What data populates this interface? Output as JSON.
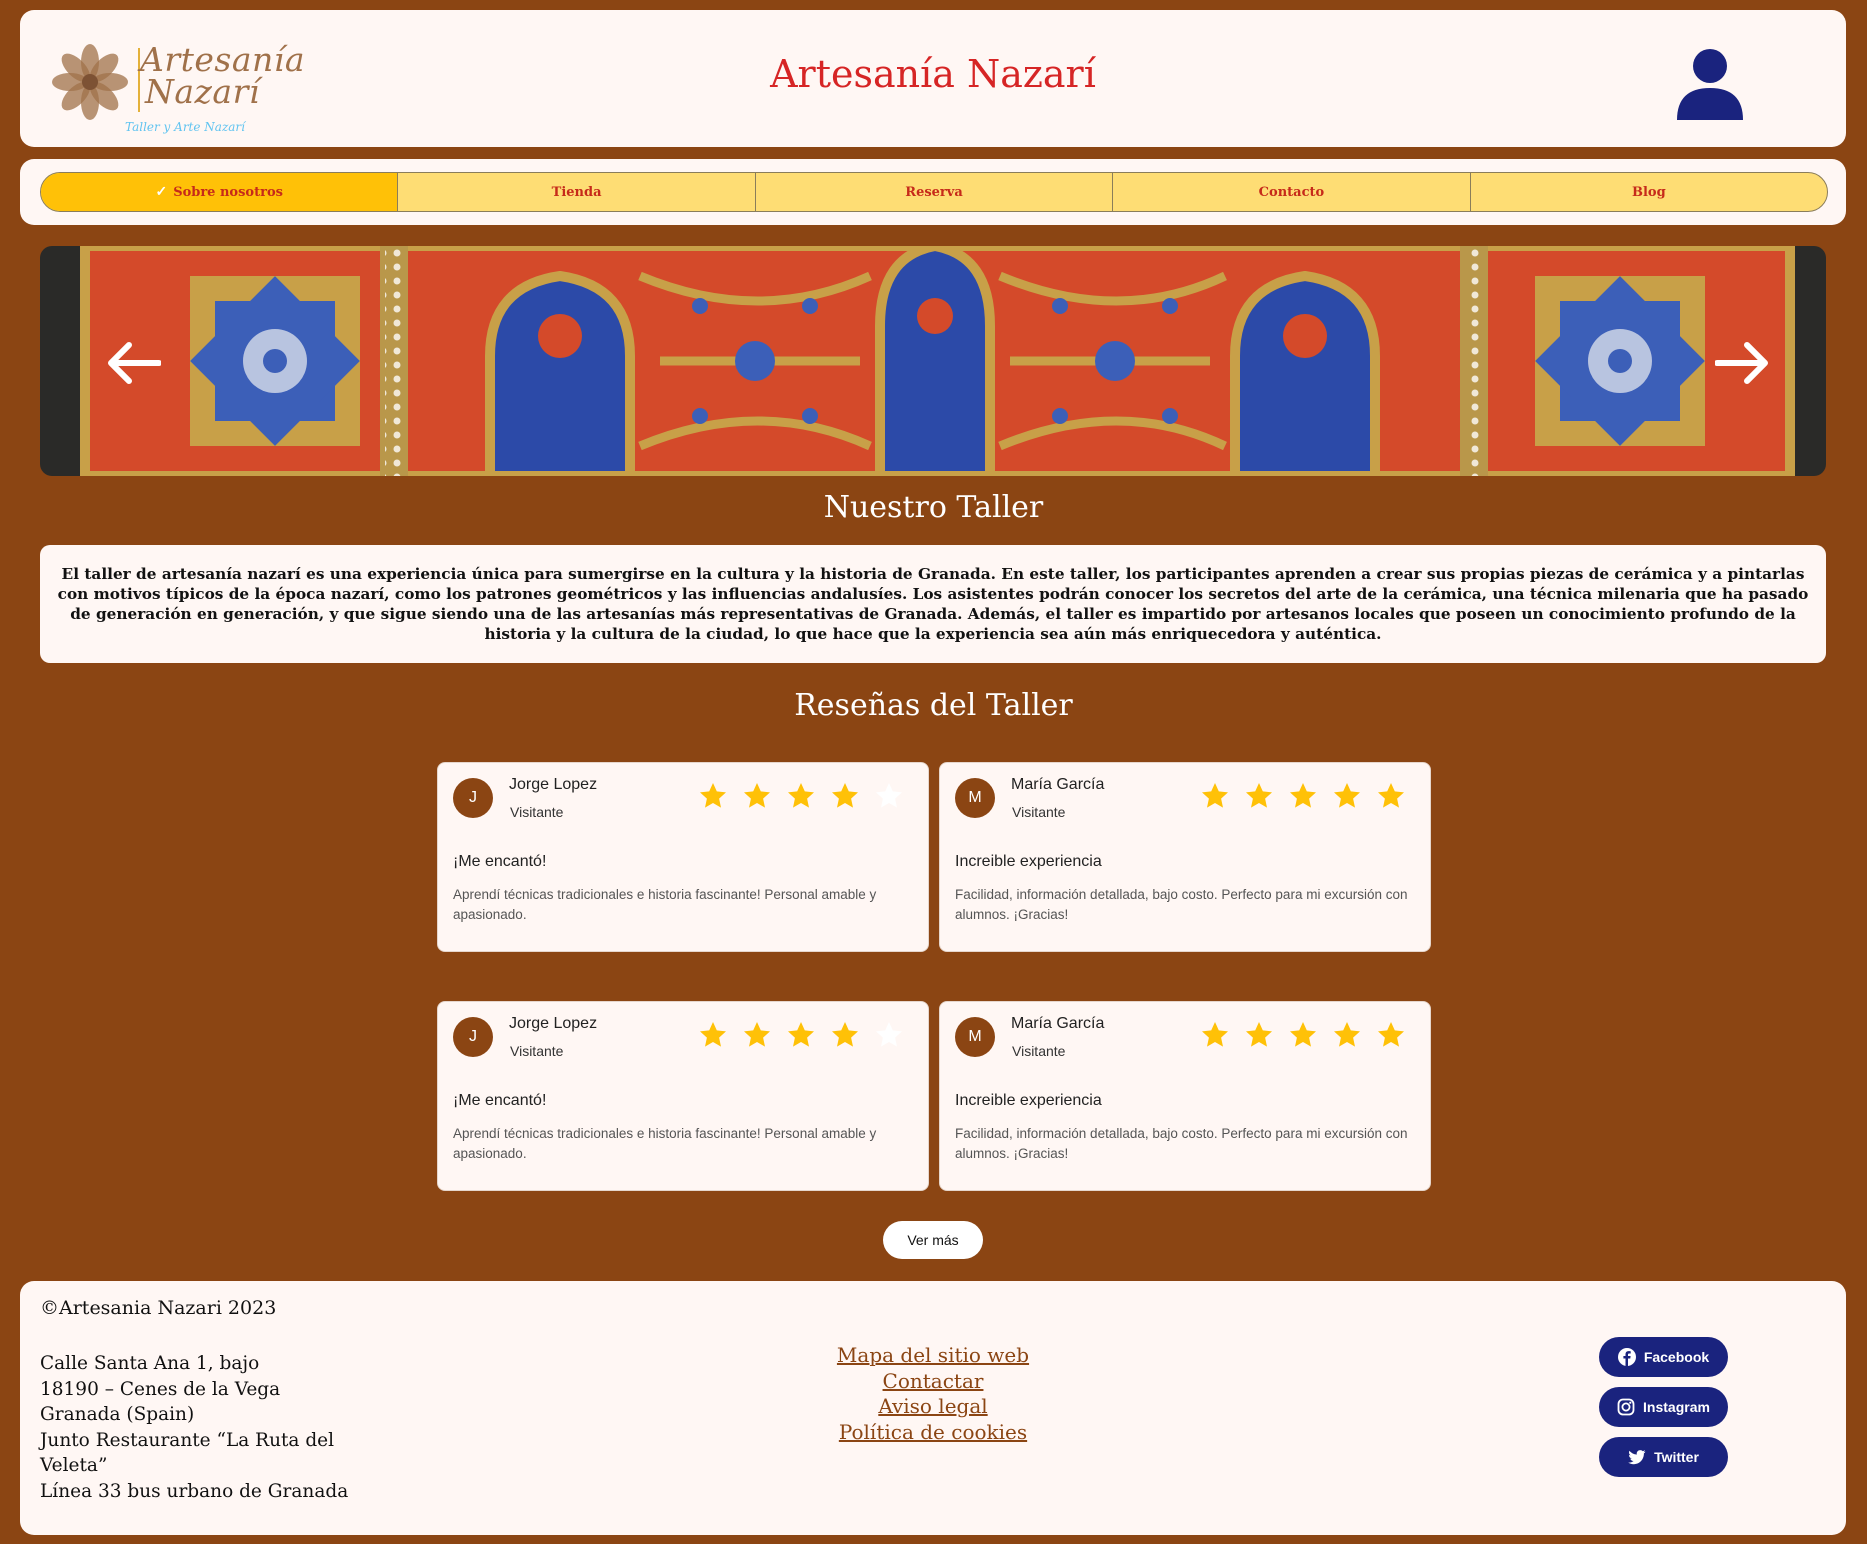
{
  "header": {
    "logo_line1": "Artesanía",
    "logo_line2": "Nazarí",
    "logo_sub": "Taller y Arte Nazarí",
    "title": "Artesanía Nazarí"
  },
  "nav": {
    "items": [
      {
        "label": "Sobre nosotros",
        "active": true
      },
      {
        "label": "Tienda"
      },
      {
        "label": "Reserva"
      },
      {
        "label": "Contacto"
      },
      {
        "label": "Blog"
      }
    ]
  },
  "section_taller": {
    "title": "Nuestro Taller",
    "text": "El taller de artesanía nazarí es una experiencia única para sumergirse en la cultura y la historia de Granada. En este taller, los participantes aprenden a crear sus propias piezas de cerámica y a pintarlas con motivos típicos de la época nazarí, como los patrones geométricos y las influencias andalusíes. Los asistentes podrán conocer los secretos del arte de la cerámica, una técnica milenaria que ha pasado de generación en generación, y que sigue siendo una de las artesanías más representativas de Granada.  Además, el taller es impartido por artesanos locales que poseen un conocimiento profundo de la historia y la cultura de la ciudad, lo que hace que la experiencia sea aún más enriquecedora y auténtica."
  },
  "reviews": {
    "title": "Reseñas del Taller",
    "items": [
      {
        "initial": "J",
        "name": "Jorge Lopez",
        "role": "Visitante",
        "rating": 4,
        "heading": "¡Me encantó!",
        "text": "Aprendí técnicas tradicionales e historia fascinante! Personal amable y apasionado."
      },
      {
        "initial": "M",
        "name": "María García",
        "role": "Visitante",
        "rating": 5,
        "heading": "Increible experiencia",
        "text": "Facilidad, información detallada, bajo costo. Perfecto para mi excursión con alumnos. ¡Gracias!"
      },
      {
        "initial": "J",
        "name": "Jorge Lopez",
        "role": "Visitante",
        "rating": 4,
        "heading": "¡Me encantó!",
        "text": "Aprendí técnicas tradicionales e historia fascinante! Personal amable y apasionado."
      },
      {
        "initial": "M",
        "name": "María García",
        "role": "Visitante",
        "rating": 5,
        "heading": "Increible experiencia",
        "text": "Facilidad, información detallada, bajo costo. Perfecto para mi excursión con alumnos. ¡Gracias!"
      }
    ],
    "more_button": "Ver más"
  },
  "footer": {
    "copyright": "©Artesania Nazari 2023",
    "address": [
      "Calle Santa Ana 1, bajo",
      "18190 – Cenes de la Vega",
      "Granada (Spain)",
      "Junto Restaurante “La Ruta del",
      "Veleta”",
      "Línea 33 bus urbano de Granada"
    ],
    "links": [
      "Mapa del sitio web",
      "Contactar",
      "Aviso legal",
      "Política de cookies"
    ],
    "social": [
      {
        "label": "Facebook",
        "icon": "facebook-icon"
      },
      {
        "label": "Instagram",
        "icon": "instagram-icon"
      },
      {
        "label": "Twitter",
        "icon": "twitter-icon"
      }
    ]
  },
  "colors": {
    "background": "#8b4513",
    "card": "#fff7f4",
    "title_red": "#d62525",
    "nav_active": "#ffc107",
    "nav_bg": "#fedd74",
    "star": "#ffc107",
    "social_bg": "#1a237e"
  }
}
